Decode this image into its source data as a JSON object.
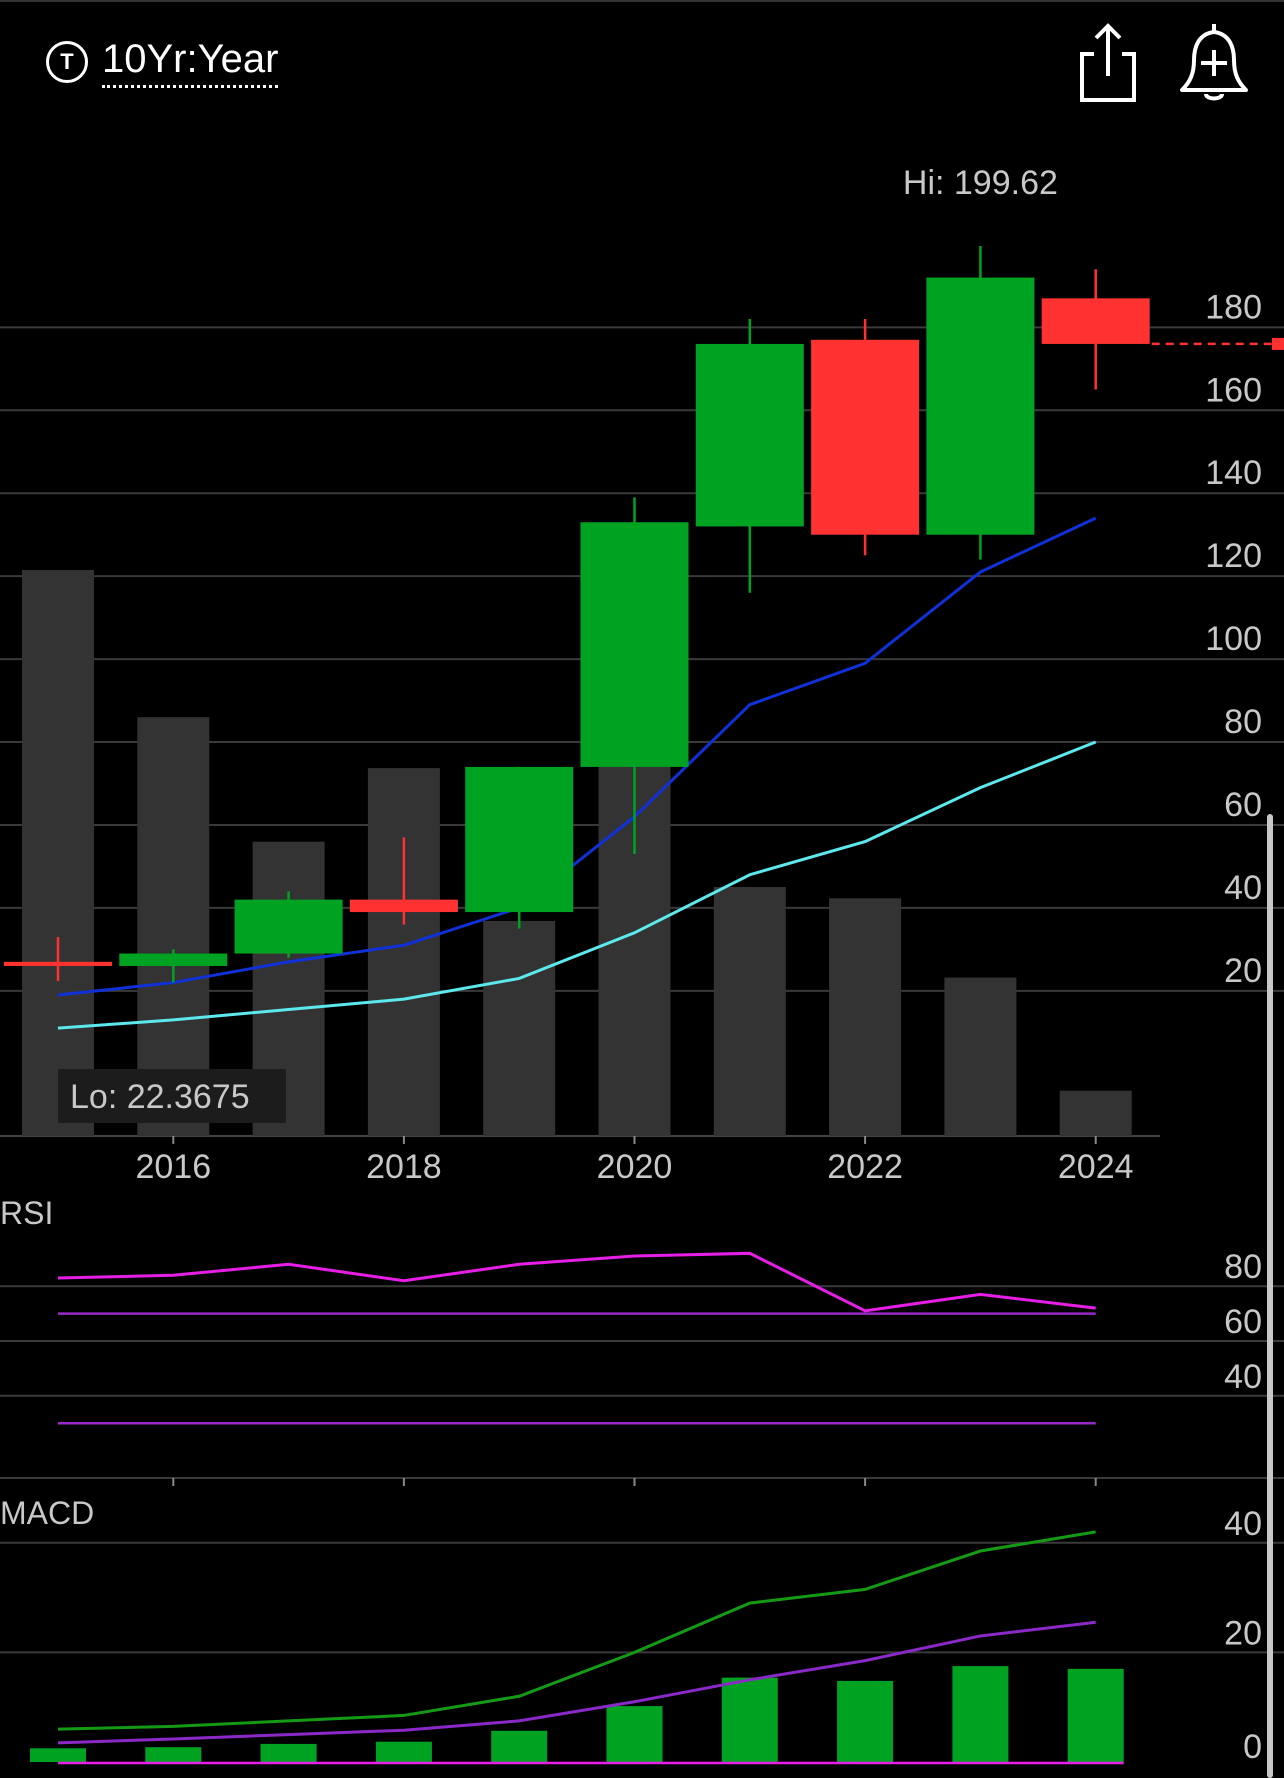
{
  "header": {
    "range_icon_letter": "T",
    "range_label": "10Yr:Year",
    "share_icon": "share-icon",
    "alert_icon": "bell-plus-icon"
  },
  "colors": {
    "up": "#00a321",
    "down": "#ff3232",
    "volume": "#333333",
    "sma_fast": "#1030d8",
    "sma_slow": "#5ce8ec",
    "rsi": "#e61ee6",
    "rsi_band": "#9a28c8",
    "macd": "#159a15",
    "macd_signal": "#8a28c8",
    "grid": "#3a3a3a"
  },
  "chart_data": [
    {
      "type": "candlestick",
      "x_ticks": [
        "2016",
        "2018",
        "2020",
        "2022",
        "2024"
      ],
      "yticks": [
        180,
        160,
        140,
        120,
        100,
        80,
        60,
        40,
        20
      ],
      "ylim": [
        -15,
        230
      ],
      "hi_label": "Hi: 199.62",
      "lo_label": "Lo: 22.3675",
      "candles": [
        {
          "year": 2015,
          "open": 27,
          "close": 26,
          "high": 33,
          "low": 22.3675
        },
        {
          "year": 2016,
          "open": 26,
          "close": 29,
          "high": 30,
          "low": 22
        },
        {
          "year": 2017,
          "open": 29,
          "close": 42,
          "high": 44,
          "low": 28
        },
        {
          "year": 2018,
          "open": 42,
          "close": 39,
          "high": 57,
          "low": 36
        },
        {
          "year": 2019,
          "open": 39,
          "close": 74,
          "high": 74,
          "low": 35
        },
        {
          "year": 2020,
          "open": 74,
          "close": 133,
          "high": 139,
          "low": 53
        },
        {
          "year": 2021,
          "open": 132,
          "close": 176,
          "high": 182,
          "low": 116
        },
        {
          "year": 2022,
          "open": 177,
          "close": 130,
          "high": 182,
          "low": 125
        },
        {
          "year": 2023,
          "open": 130,
          "close": 192,
          "high": 199.62,
          "low": 124
        },
        {
          "year": 2024,
          "open": 187,
          "close": 176,
          "high": 194,
          "low": 165
        }
      ],
      "last_price": 176,
      "sma_fast": [
        {
          "year": 2015,
          "value": 19
        },
        {
          "year": 2016,
          "value": 22
        },
        {
          "year": 2017,
          "value": 27
        },
        {
          "year": 2018,
          "value": 31
        },
        {
          "year": 2019,
          "value": 40
        },
        {
          "year": 2020,
          "value": 62
        },
        {
          "year": 2021,
          "value": 89
        },
        {
          "year": 2022,
          "value": 99
        },
        {
          "year": 2023,
          "value": 121
        },
        {
          "year": 2024,
          "value": 134
        }
      ],
      "sma_slow": [
        {
          "year": 2015,
          "value": 11
        },
        {
          "year": 2016,
          "value": 13
        },
        {
          "year": 2017,
          "value": 15.5
        },
        {
          "year": 2018,
          "value": 18
        },
        {
          "year": 2019,
          "value": 23
        },
        {
          "year": 2020,
          "value": 34
        },
        {
          "year": 2021,
          "value": 48
        },
        {
          "year": 2022,
          "value": 56
        },
        {
          "year": 2023,
          "value": 69
        },
        {
          "year": 2024,
          "value": 80
        }
      ],
      "volume": [
        {
          "year": 2015,
          "value": 100
        },
        {
          "year": 2016,
          "value": 74
        },
        {
          "year": 2017,
          "value": 52
        },
        {
          "year": 2018,
          "value": 65
        },
        {
          "year": 2019,
          "value": 38
        },
        {
          "year": 2020,
          "value": 66
        },
        {
          "year": 2021,
          "value": 44
        },
        {
          "year": 2022,
          "value": 42
        },
        {
          "year": 2023,
          "value": 28
        },
        {
          "year": 2024,
          "value": 8
        }
      ]
    },
    {
      "type": "line",
      "title": "RSI",
      "yticks": [
        80,
        60,
        40
      ],
      "ylim": [
        10,
        110
      ],
      "series": [
        {
          "values": [
            {
              "year": 2015,
              "value": 83
            },
            {
              "year": 2016,
              "value": 84
            },
            {
              "year": 2017,
              "value": 88
            },
            {
              "year": 2018,
              "value": 82
            },
            {
              "year": 2019,
              "value": 88
            },
            {
              "year": 2020,
              "value": 91
            },
            {
              "year": 2021,
              "value": 92
            },
            {
              "year": 2022,
              "value": 71
            },
            {
              "year": 2023,
              "value": 77
            },
            {
              "year": 2024,
              "value": 72
            }
          ]
        }
      ],
      "bands": [
        70,
        30
      ]
    },
    {
      "type": "line",
      "title": "MACD",
      "yticks": [
        40,
        20,
        0
      ],
      "ylim": [
        0,
        50
      ],
      "macd": [
        {
          "year": 2015,
          "value": 6
        },
        {
          "year": 2016,
          "value": 6.5
        },
        {
          "year": 2017,
          "value": 7.5
        },
        {
          "year": 2018,
          "value": 8.5
        },
        {
          "year": 2019,
          "value": 12
        },
        {
          "year": 2020,
          "value": 20
        },
        {
          "year": 2021,
          "value": 29
        },
        {
          "year": 2022,
          "value": 31.5
        },
        {
          "year": 2023,
          "value": 38.5
        },
        {
          "year": 2024,
          "value": 42
        }
      ],
      "signal": [
        {
          "year": 2015,
          "value": 3.5
        },
        {
          "year": 2016,
          "value": 4.2
        },
        {
          "year": 2017,
          "value": 5
        },
        {
          "year": 2018,
          "value": 5.8
        },
        {
          "year": 2019,
          "value": 7.5
        },
        {
          "year": 2020,
          "value": 11
        },
        {
          "year": 2021,
          "value": 15
        },
        {
          "year": 2022,
          "value": 18.5
        },
        {
          "year": 2023,
          "value": 23
        },
        {
          "year": 2024,
          "value": 25.5
        }
      ],
      "histogram": [
        {
          "year": 2015,
          "value": 2.5
        },
        {
          "year": 2016,
          "value": 2.7
        },
        {
          "year": 2017,
          "value": 3.3
        },
        {
          "year": 2018,
          "value": 3.7
        },
        {
          "year": 2019,
          "value": 5.7
        },
        {
          "year": 2020,
          "value": 10.2
        },
        {
          "year": 2021,
          "value": 15.4
        },
        {
          "year": 2022,
          "value": 14.8
        },
        {
          "year": 2023,
          "value": 17.5
        },
        {
          "year": 2024,
          "value": 17
        }
      ]
    }
  ]
}
